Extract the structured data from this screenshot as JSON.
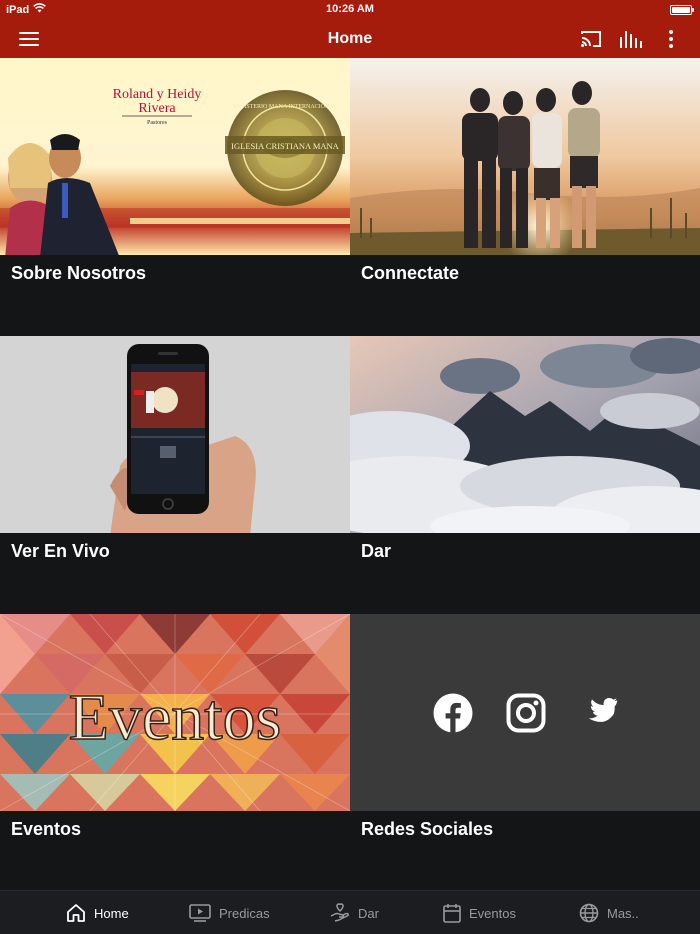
{
  "status": {
    "device": "iPad",
    "time": "10:26 AM"
  },
  "nav": {
    "title": "Home"
  },
  "tiles": [
    {
      "label": "Sobre Nosotros",
      "banner": {
        "names_line1": "Roland y Heidy",
        "names_line2": "Rivera",
        "role": "Pastores",
        "seal_top": "MINISTERIO MANA INTERNACIONAL",
        "seal_band": "IGLESIA CRISTIANA MANA"
      }
    },
    {
      "label": "Connectate"
    },
    {
      "label": "Ver En Vivo"
    },
    {
      "label": "Dar"
    },
    {
      "label": "Eventos",
      "banner_text": "Eventos"
    },
    {
      "label": "Redes Sociales"
    }
  ],
  "tabs": [
    {
      "label": "Home",
      "icon": "home-icon"
    },
    {
      "label": "Predicas",
      "icon": "video-icon"
    },
    {
      "label": "Dar",
      "icon": "give-icon"
    },
    {
      "label": "Eventos",
      "icon": "calendar-icon"
    },
    {
      "label": "Mas..",
      "icon": "globe-icon"
    }
  ],
  "colors": {
    "brand": "#a51c0c",
    "background": "#141517",
    "tabbar": "#1c1d20",
    "social_panel": "#3a3a3a"
  }
}
